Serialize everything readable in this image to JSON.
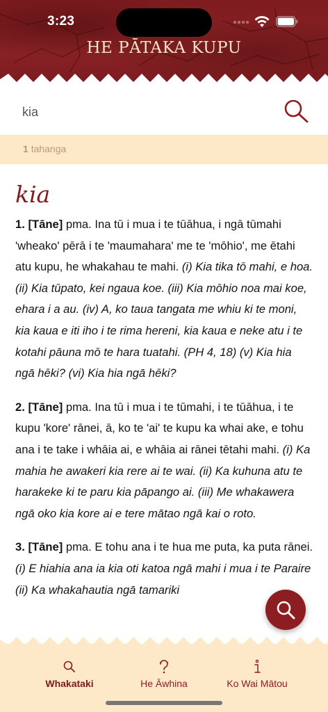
{
  "status_bar": {
    "time": "3:23"
  },
  "app": {
    "title": "HE PĀTAKA KUPU"
  },
  "search": {
    "value": "kia",
    "placeholder": ""
  },
  "results": {
    "count": "1",
    "label": "tahanga"
  },
  "entry": {
    "headword": "kia",
    "definitions": [
      {
        "number": "1.",
        "tag": "[Tāne]",
        "text": " pma. Ina tū i mua i te tūāhua, i ngā tūmahi 'wheako' pērā i te 'maumahara' me te 'mōhio', me ētahi atu kupu, he whakahau te mahi. ",
        "examples": "(i) Kia tika tō mahi, e hoa. (ii) Kia tūpato, kei ngaua koe. (iii) Kia mōhio noa mai koe, ehara i a au. (iv) A, ko taua tangata me whiu ki te moni, kia kaua e iti iho i te rima hereni, kia kaua e neke atu i te kotahi pāuna mō te hara tuatahi. (PH 4, 18) (v) Kia hia ngā hēki? (vi) Kia hia ngā hēki?"
      },
      {
        "number": "2.",
        "tag": "[Tāne]",
        "text": " pma. Ina tū i mua i te tūmahi, i te tūāhua, i te kupu 'kore' rānei, ā, ko te 'ai' te kupu ka whai ake, e tohu ana i te take i whāia ai, e whāia ai rānei tētahi mahi. ",
        "examples": "(i) Ka mahia he awakeri kia rere ai te wai. (ii) Ka kuhuna atu te harakeke ki te paru kia pāpango ai. (iii) Me whakawera ngā oko kia kore ai e tere mātao ngā kai o roto."
      },
      {
        "number": "3.",
        "tag": "[Tāne]",
        "text": " pma. E tohu ana i te hua me puta, ka puta rānei. ",
        "examples": "(i) E hiahia ana ia kia oti katoa ngā mahi i mua i te Paraire (ii) Ka whakahautia ngā tamariki"
      }
    ]
  },
  "bottom_nav": {
    "items": [
      {
        "label": "Whakataki",
        "icon": "search-icon",
        "active": true
      },
      {
        "label": "He Āwhina",
        "icon": "help-icon",
        "active": false
      },
      {
        "label": "Ko Wai Mātou",
        "icon": "info-icon",
        "active": false
      }
    ]
  },
  "colors": {
    "brand": "#8c1e22",
    "header": "#7e1c1f",
    "cream": "#fde9c8",
    "title_text": "#f6e2c6"
  }
}
